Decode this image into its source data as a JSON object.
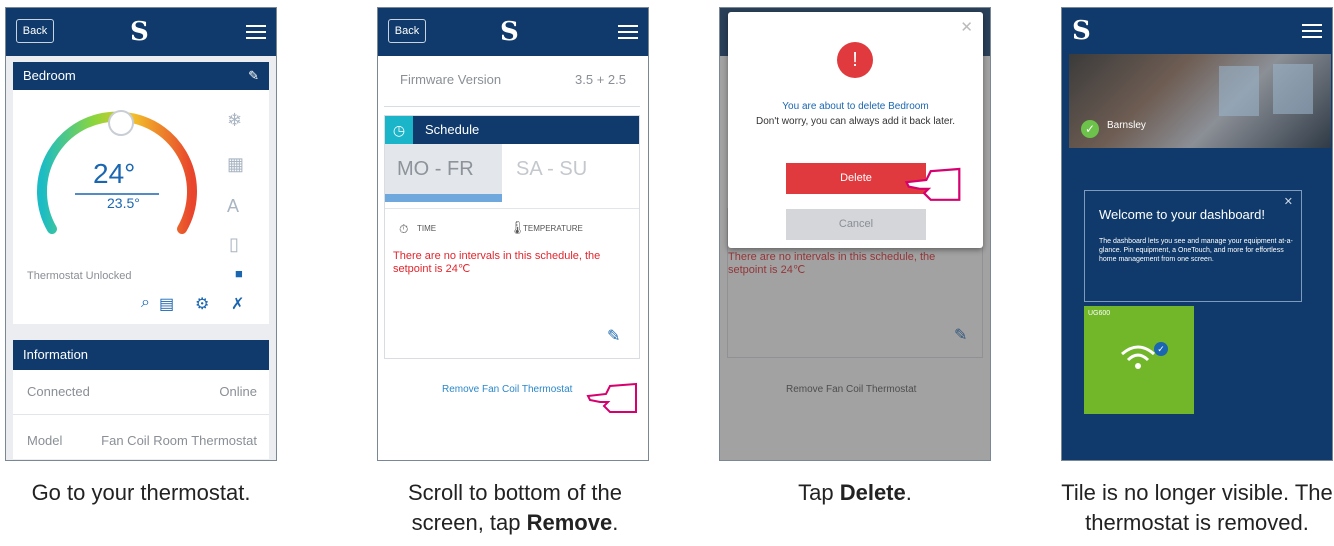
{
  "brand": {
    "primary": "#0f3a6b",
    "accent_red": "#e03a3e",
    "link_blue": "#1a66b0",
    "tile_green": "#72b62a",
    "hand_pink": "#d6006f"
  },
  "common": {
    "back_label": "Back",
    "logo_glyph": "S"
  },
  "step1": {
    "room_title": "Bedroom",
    "set_temp": "24°",
    "current_temp": "23.5°",
    "lock_status": "Thermostat Unlocked",
    "info_title": "Information",
    "rows": [
      {
        "label": "Connected",
        "value": "Online"
      },
      {
        "label": "Model",
        "value": "Fan Coil Room Thermostat"
      }
    ],
    "caption": "Go to your thermostat."
  },
  "step2": {
    "firmware_label": "Firmware Version",
    "firmware_value": "3.5 + 2.5",
    "schedule_title": "Schedule",
    "tab_weekdays": "MO - FR",
    "tab_weekend": "SA - SU",
    "col_time": "TIME",
    "col_temp": "TEMPERATURE",
    "warning": "There are no intervals in this schedule, the setpoint is 24℃",
    "remove_link": "Remove Fan Coil Thermostat",
    "caption_line1": "Scroll to bottom of the",
    "caption_line2_prefix": "screen, tap ",
    "caption_line2_bold": "Remove",
    "caption_line2_suffix": "."
  },
  "step3": {
    "dialog_line1": "You are about to delete Bedroom",
    "dialog_line2": "Don't worry, you can always add it back later.",
    "delete_label": "Delete",
    "cancel_label": "Cancel",
    "bg_warning": "There are no intervals in this schedule, the setpoint is 24℃",
    "bg_remove": "Remove Fan Coil Thermostat",
    "caption_prefix": "Tap ",
    "caption_bold": "Delete",
    "caption_suffix": "."
  },
  "step4": {
    "location": "Barnsley",
    "welcome_title": "Welcome to your dashboard!",
    "welcome_body": "The dashboard lets you see and manage your equipment at-a-glance. Pin equipment, a OneTouch, and more for effortless home management from one screen.",
    "tile_label": "UG600",
    "caption_line1": "Tile is no longer visible. The",
    "caption_line2": "thermostat is removed."
  }
}
